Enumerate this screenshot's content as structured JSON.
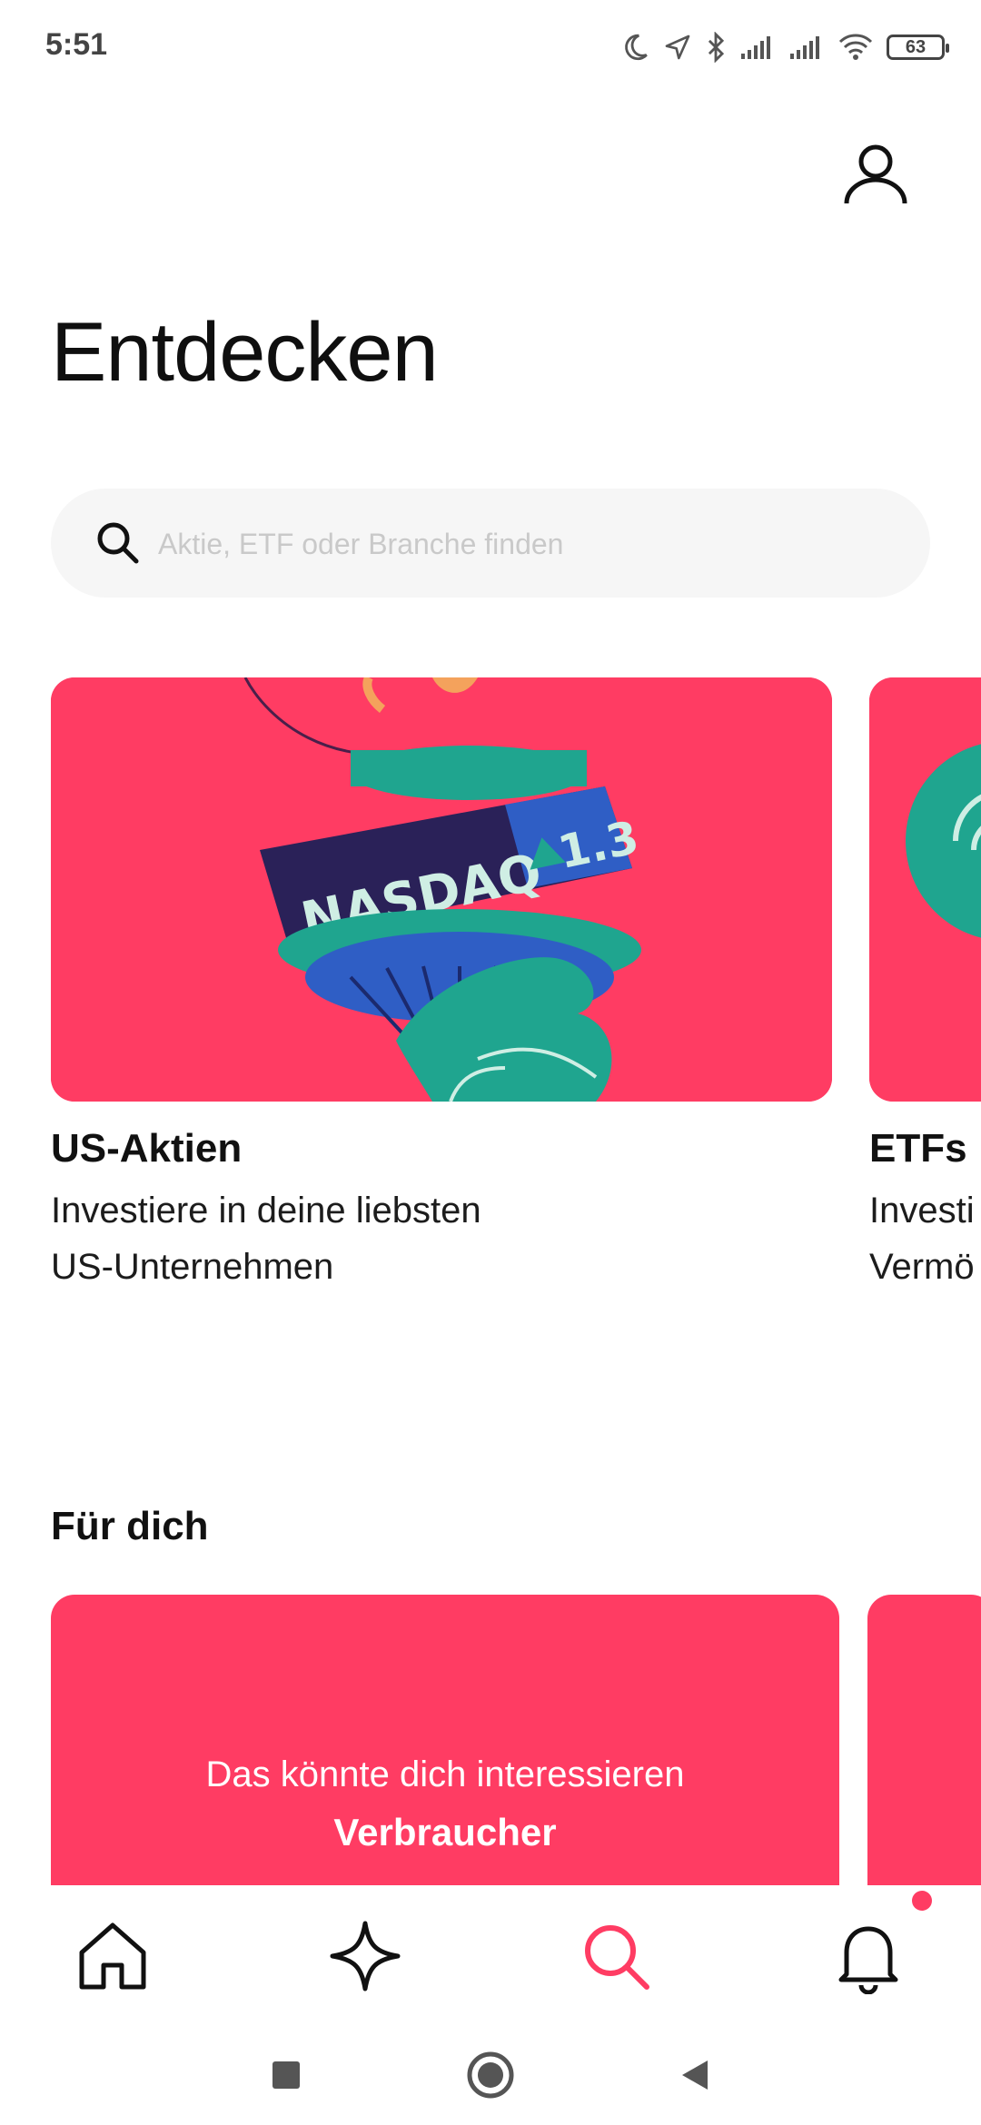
{
  "status_bar": {
    "time": "5:51",
    "battery_level": "63",
    "icons": [
      "moon-icon",
      "location-icon",
      "bluetooth-icon",
      "signal-icon",
      "signal-icon",
      "wifi-icon",
      "battery-icon"
    ]
  },
  "header": {
    "title": "Entdecken",
    "profile_icon": "person-icon"
  },
  "search": {
    "placeholder": "Aktie, ETF oder Branche finden",
    "value": ""
  },
  "featured": [
    {
      "title": "US-Aktien",
      "description": "Investiere in deine liebsten\nUS-Unternehmen",
      "image": {
        "ticker": "NASDAQ",
        "change": "1.3"
      }
    },
    {
      "title": "ETFs",
      "description": "Investi\nVermö"
    }
  ],
  "for_you": {
    "title": "Für dich",
    "card": {
      "subtitle": "Das könnte dich interessieren",
      "category": "Verbraucher"
    }
  },
  "bottom_nav": {
    "items": [
      {
        "icon": "home-icon",
        "active": false
      },
      {
        "icon": "sparkle-icon",
        "active": false
      },
      {
        "icon": "search-icon",
        "active": true
      },
      {
        "icon": "bell-icon",
        "active": false,
        "has_notification": true
      }
    ]
  },
  "system_nav": [
    "recents-button",
    "home-button",
    "back-button"
  ],
  "colors": {
    "accent": "#ff3c63",
    "text": "#111111",
    "search_bg": "#f6f6f6",
    "placeholder": "#c9c9c9"
  }
}
